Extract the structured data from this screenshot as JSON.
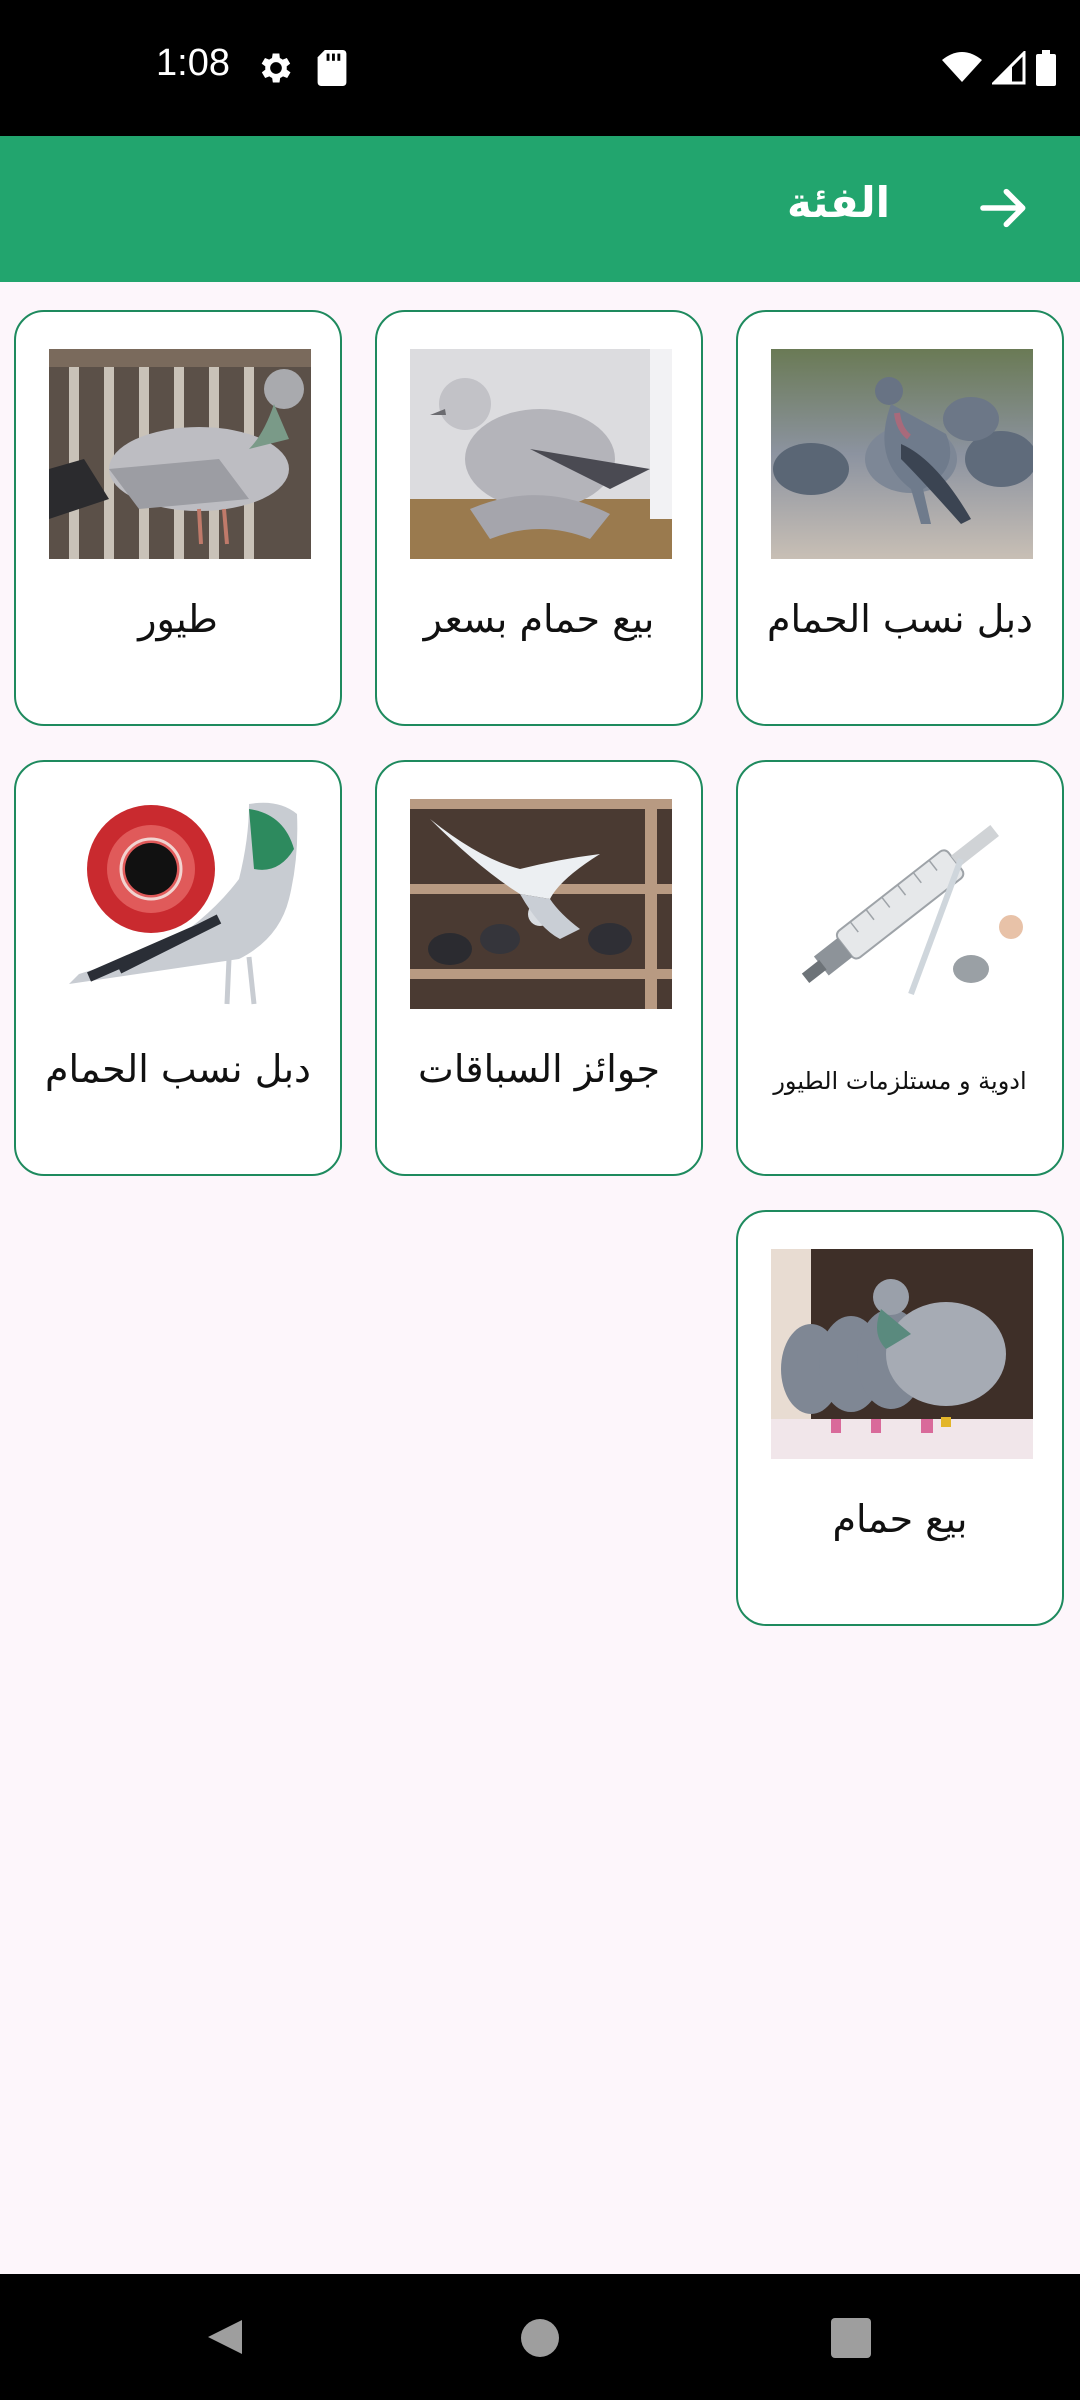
{
  "status_bar": {
    "time": "1:08",
    "icons": [
      "gear-icon",
      "sd-card-icon",
      "wifi-icon",
      "signal-icon",
      "battery-icon"
    ]
  },
  "app_bar": {
    "title": "الفئة",
    "back_icon": "arrow-right-icon",
    "background": "#22a56e"
  },
  "categories": [
    {
      "label": "دبل نسب الحمام",
      "image": "pigeon-flock-photo"
    },
    {
      "label": "بيع حمام بسعر",
      "image": "white-fantail-pigeon-photo"
    },
    {
      "label": "طيور",
      "image": "racing-pigeon-photo"
    },
    {
      "label": "ادوية و مستلزمات الطيور",
      "image": "syringe-feeder-photo"
    },
    {
      "label": "جوائز السباقات",
      "image": "pigeon-loft-photo"
    },
    {
      "label": "دبل نسب الحمام",
      "image": "pigeon-eye-photo"
    },
    {
      "label": "بيع حمام",
      "image": "pigeons-row-photo"
    }
  ],
  "navigation": {
    "icons": [
      "back-triangle-icon",
      "home-circle-icon",
      "recents-square-icon"
    ]
  },
  "colors": {
    "accent": "#22a56e",
    "card_border": "#1e8a5e",
    "background": "#fdf6fb"
  }
}
